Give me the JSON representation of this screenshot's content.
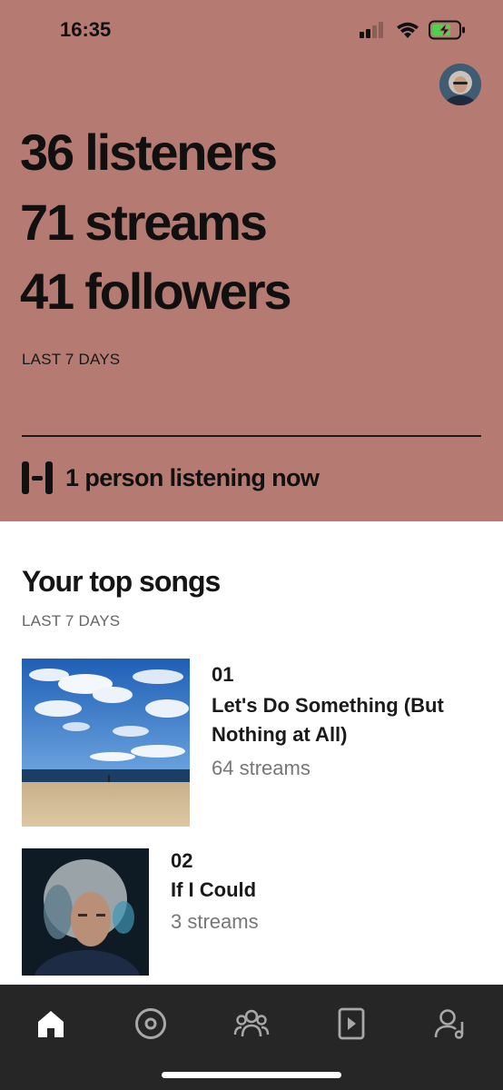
{
  "status_bar": {
    "time": "16:35",
    "icons": [
      "cellular-signal-icon",
      "wifi-icon",
      "battery-charging-icon"
    ]
  },
  "header": {
    "avatar_icon": "profile-photo"
  },
  "stats": {
    "listeners": "36 listeners",
    "streams": "71 streams",
    "followers": "41 followers",
    "period": "LAST 7 DAYS"
  },
  "live": {
    "icon": "live-listeners-icon",
    "text": "1 person listening now"
  },
  "top_songs": {
    "title": "Your top songs",
    "period": "LAST 7 DAYS",
    "songs": [
      {
        "rank": "01",
        "title_line1": "Let's Do Something (But",
        "title_line2": "Nothing at All)",
        "streams": "64 streams",
        "art": "beach-sky-artwork"
      },
      {
        "rank": "02",
        "title_line1": "If I Could",
        "streams": "3 streams",
        "art": "portrait-artwork"
      }
    ]
  },
  "tab_bar": {
    "tabs": [
      {
        "icon": "home-icon",
        "active": true
      },
      {
        "icon": "music-disc-icon",
        "active": false
      },
      {
        "icon": "audience-icon",
        "active": false
      },
      {
        "icon": "video-icon",
        "active": false
      },
      {
        "icon": "profile-music-icon",
        "active": false
      }
    ]
  },
  "colors": {
    "hero_background": "#b57b73",
    "tab_bar_background": "#262626"
  }
}
